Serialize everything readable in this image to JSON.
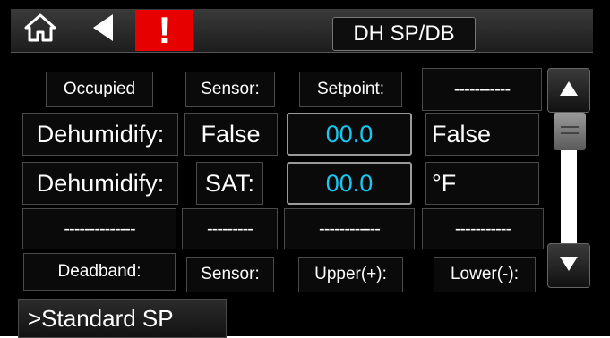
{
  "header": {
    "title": "DH SP/DB",
    "home_icon": "home-icon",
    "back_icon": "back-arrow-icon",
    "alarm_icon": "!"
  },
  "rows": [
    {
      "c1": "Occupied",
      "c2": "Sensor:",
      "c3": "Setpoint:",
      "c4": "-----------"
    },
    {
      "c1": "Dehumidify:",
      "c2": "False",
      "c3": "00.0",
      "c4": "False"
    },
    {
      "c1": "Dehumidify:",
      "c2": "SAT:",
      "c3": "00.0",
      "c4": "°F"
    },
    {
      "c1": "--------------",
      "c2": "---------",
      "c3": "------------",
      "c4": "-----------"
    },
    {
      "c1": "Deadband:",
      "c2": "Sensor:",
      "c3": "Upper(+):",
      "c4": "Lower(-):"
    }
  ],
  "footer": {
    "nav_label": ">Standard SP"
  },
  "colors": {
    "alarm": "#e60000",
    "value_text": "#17c9f2",
    "background": "#000000"
  }
}
